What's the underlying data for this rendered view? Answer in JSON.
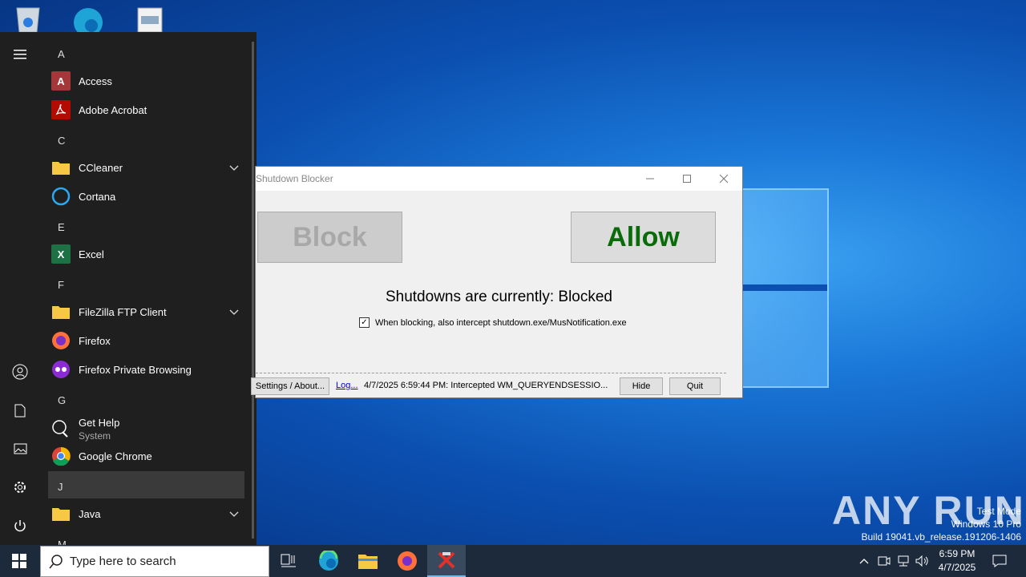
{
  "desktop": {
    "watermark_lines": [
      "Test Mode",
      "Windows 10 Pro",
      "Build 19041.vb_release.191206-1406"
    ],
    "anyrun_logo": "ANY RUN"
  },
  "start_menu": {
    "sections": [
      {
        "letter": "A",
        "apps": [
          {
            "label": "Access",
            "icon": "access-icon"
          },
          {
            "label": "Adobe Acrobat",
            "icon": "acrobat-icon"
          }
        ]
      },
      {
        "letter": "C",
        "apps": [
          {
            "label": "CCleaner",
            "icon": "folder-icon",
            "expandable": true
          },
          {
            "label": "Cortana",
            "icon": "cortana-icon"
          }
        ]
      },
      {
        "letter": "E",
        "apps": [
          {
            "label": "Excel",
            "icon": "excel-icon"
          }
        ]
      },
      {
        "letter": "F",
        "apps": [
          {
            "label": "FileZilla FTP Client",
            "icon": "folder-icon",
            "expandable": true
          },
          {
            "label": "Firefox",
            "icon": "firefox-icon"
          },
          {
            "label": "Firefox Private Browsing",
            "icon": "firefox-private-icon"
          }
        ]
      },
      {
        "letter": "G",
        "apps": [
          {
            "label": "Get Help",
            "sub": "System",
            "icon": "get-help-icon"
          },
          {
            "label": "Google Chrome",
            "icon": "chrome-icon"
          }
        ]
      },
      {
        "letter": "J",
        "apps": [
          {
            "label": "Java",
            "icon": "folder-icon",
            "expandable": true
          }
        ]
      },
      {
        "letter": "M",
        "apps": []
      }
    ]
  },
  "dialog": {
    "title": "Shutdown Blocker",
    "block_label": "Block",
    "allow_label": "Allow",
    "status_text": "Shutdowns are currently: Blocked",
    "checkbox_label": "When blocking, also intercept shutdown.exe/MusNotification.exe",
    "checkbox_checked": true,
    "settings_label": "Settings / About...",
    "log_link": "Log...",
    "log_text": "4/7/2025 6:59:44 PM: Intercepted WM_QUERYENDSESSIO...",
    "hide_label": "Hide",
    "quit_label": "Quit"
  },
  "taskbar": {
    "search_placeholder": "Type here to search",
    "time": "6:59 PM",
    "date": "4/7/2025"
  }
}
